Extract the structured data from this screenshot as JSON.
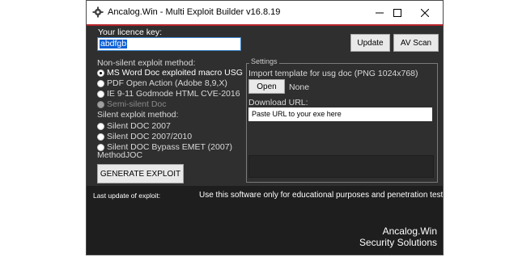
{
  "window": {
    "title": "Ancalog.Win - Multi Exploit Builder v16.8.19",
    "icon": "gear-icon",
    "accent_color": "#b8262c",
    "controls": [
      "minimize-icon",
      "maximize-icon",
      "close-icon"
    ]
  },
  "licence": {
    "label": "Your licence key:",
    "value": "abdfgb"
  },
  "toolbar": {
    "update_label": "Update",
    "av_scan_label": "AV Scan"
  },
  "non_silent": {
    "heading": "Non-silent exploit method:",
    "options": [
      {
        "label": "MS Word Doc exploited macro USG",
        "checked": true,
        "disabled": false
      },
      {
        "label": "PDF Open Action (Adobe 8,9,X)",
        "checked": false,
        "disabled": false
      },
      {
        "label": "IE 9-11 Godmode HTML CVE-2016",
        "checked": false,
        "disabled": false
      },
      {
        "label": "Semi-silent Doc",
        "checked": false,
        "disabled": true
      }
    ]
  },
  "silent": {
    "heading": "Silent exploit method:",
    "options": [
      {
        "label": "Silent DOC 2007",
        "checked": false
      },
      {
        "label": "Silent DOC 2007/2010",
        "checked": false
      },
      {
        "label": "Silent DOC Bypass EMET (2007)",
        "checked": false
      }
    ],
    "method_label": "MethodJOC"
  },
  "generate_label": "GENERATE EXPLOIT",
  "settings": {
    "title": "Settings",
    "template_label": "Import template for usg doc (PNG 1024x768)",
    "open_label": "Open",
    "template_value": "None",
    "download_label": "Download URL:",
    "download_value": "Paste URL to your exe here"
  },
  "footer": {
    "status_label": "Last update of exploit:",
    "status_message": "Use this software only for educational purposes and penetration tests",
    "brand_line1": "Ancalog.Win",
    "brand_line2": "Security Solutions"
  }
}
